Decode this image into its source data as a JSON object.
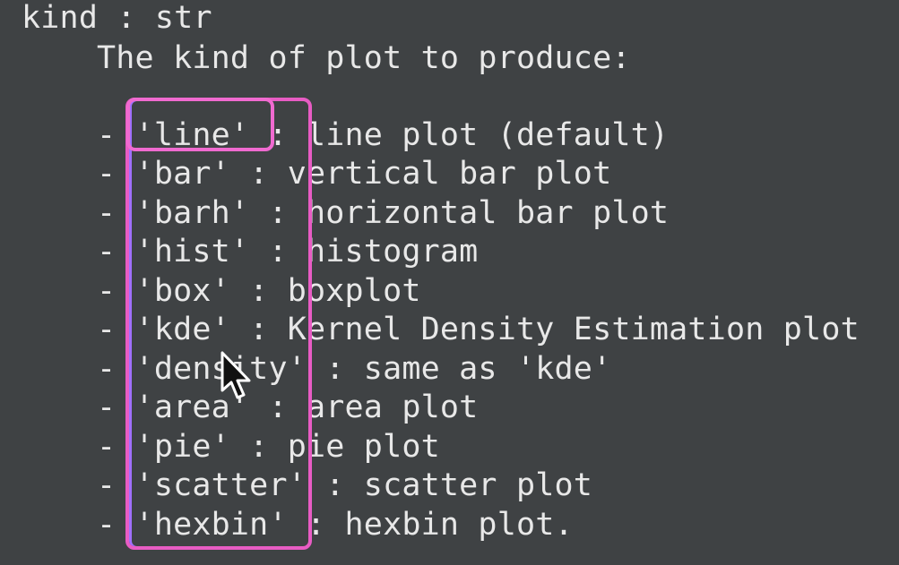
{
  "docstring": {
    "param_signature": "kind : str",
    "description": "The kind of plot to produce:",
    "items": [
      {
        "text": "- 'line' : line plot (default)"
      },
      {
        "text": "- 'bar' : vertical bar plot"
      },
      {
        "text": "- 'barh' : horizontal bar plot"
      },
      {
        "text": "- 'hist' : histogram"
      },
      {
        "text": "- 'box' : boxplot"
      },
      {
        "text": "- 'kde' : Kernel Density Estimation plot"
      },
      {
        "text": "- 'density' : same as 'kde'"
      },
      {
        "text": "- 'area' : area plot"
      },
      {
        "text": "- 'pie' : pie plot"
      },
      {
        "text": "- 'scatter' : scatter plot"
      },
      {
        "text": "- 'hexbin' : hexbin plot."
      }
    ]
  },
  "colors": {
    "background": "#3f4244",
    "text": "#e8e8e8",
    "highlight": "#e85cc4",
    "highlight_inner": "#a070ff"
  },
  "icons": {
    "cursor": "mouse-pointer-icon"
  }
}
